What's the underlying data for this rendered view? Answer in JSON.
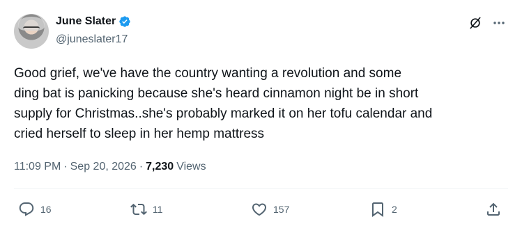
{
  "author": {
    "name": "June Slater",
    "handle": "@juneslater17",
    "verified_color": "#1d9bf0"
  },
  "tweet": {
    "text": "Good grief, we've have the country wanting a revolution and some\nding bat is panicking because she's heard cinnamon night be in short\nsupply for Christmas..she's probably marked it on her tofu calendar and\ncried herself to sleep in her hemp mattress",
    "time": "11:09 PM",
    "separator": "·",
    "date": "Sep 20, 2026",
    "views_count": "7,230",
    "views_label": "Views"
  },
  "actions": {
    "reply_count": "16",
    "retweet_count": "11",
    "like_count": "157",
    "bookmark_count": "2"
  },
  "icons": {
    "reply": "reply-icon",
    "retweet": "retweet-icon",
    "like": "heart-icon",
    "bookmark": "bookmark-icon",
    "share": "share-icon",
    "grok": "grok-icon",
    "more": "more-icon",
    "verified": "verified-badge-icon"
  }
}
